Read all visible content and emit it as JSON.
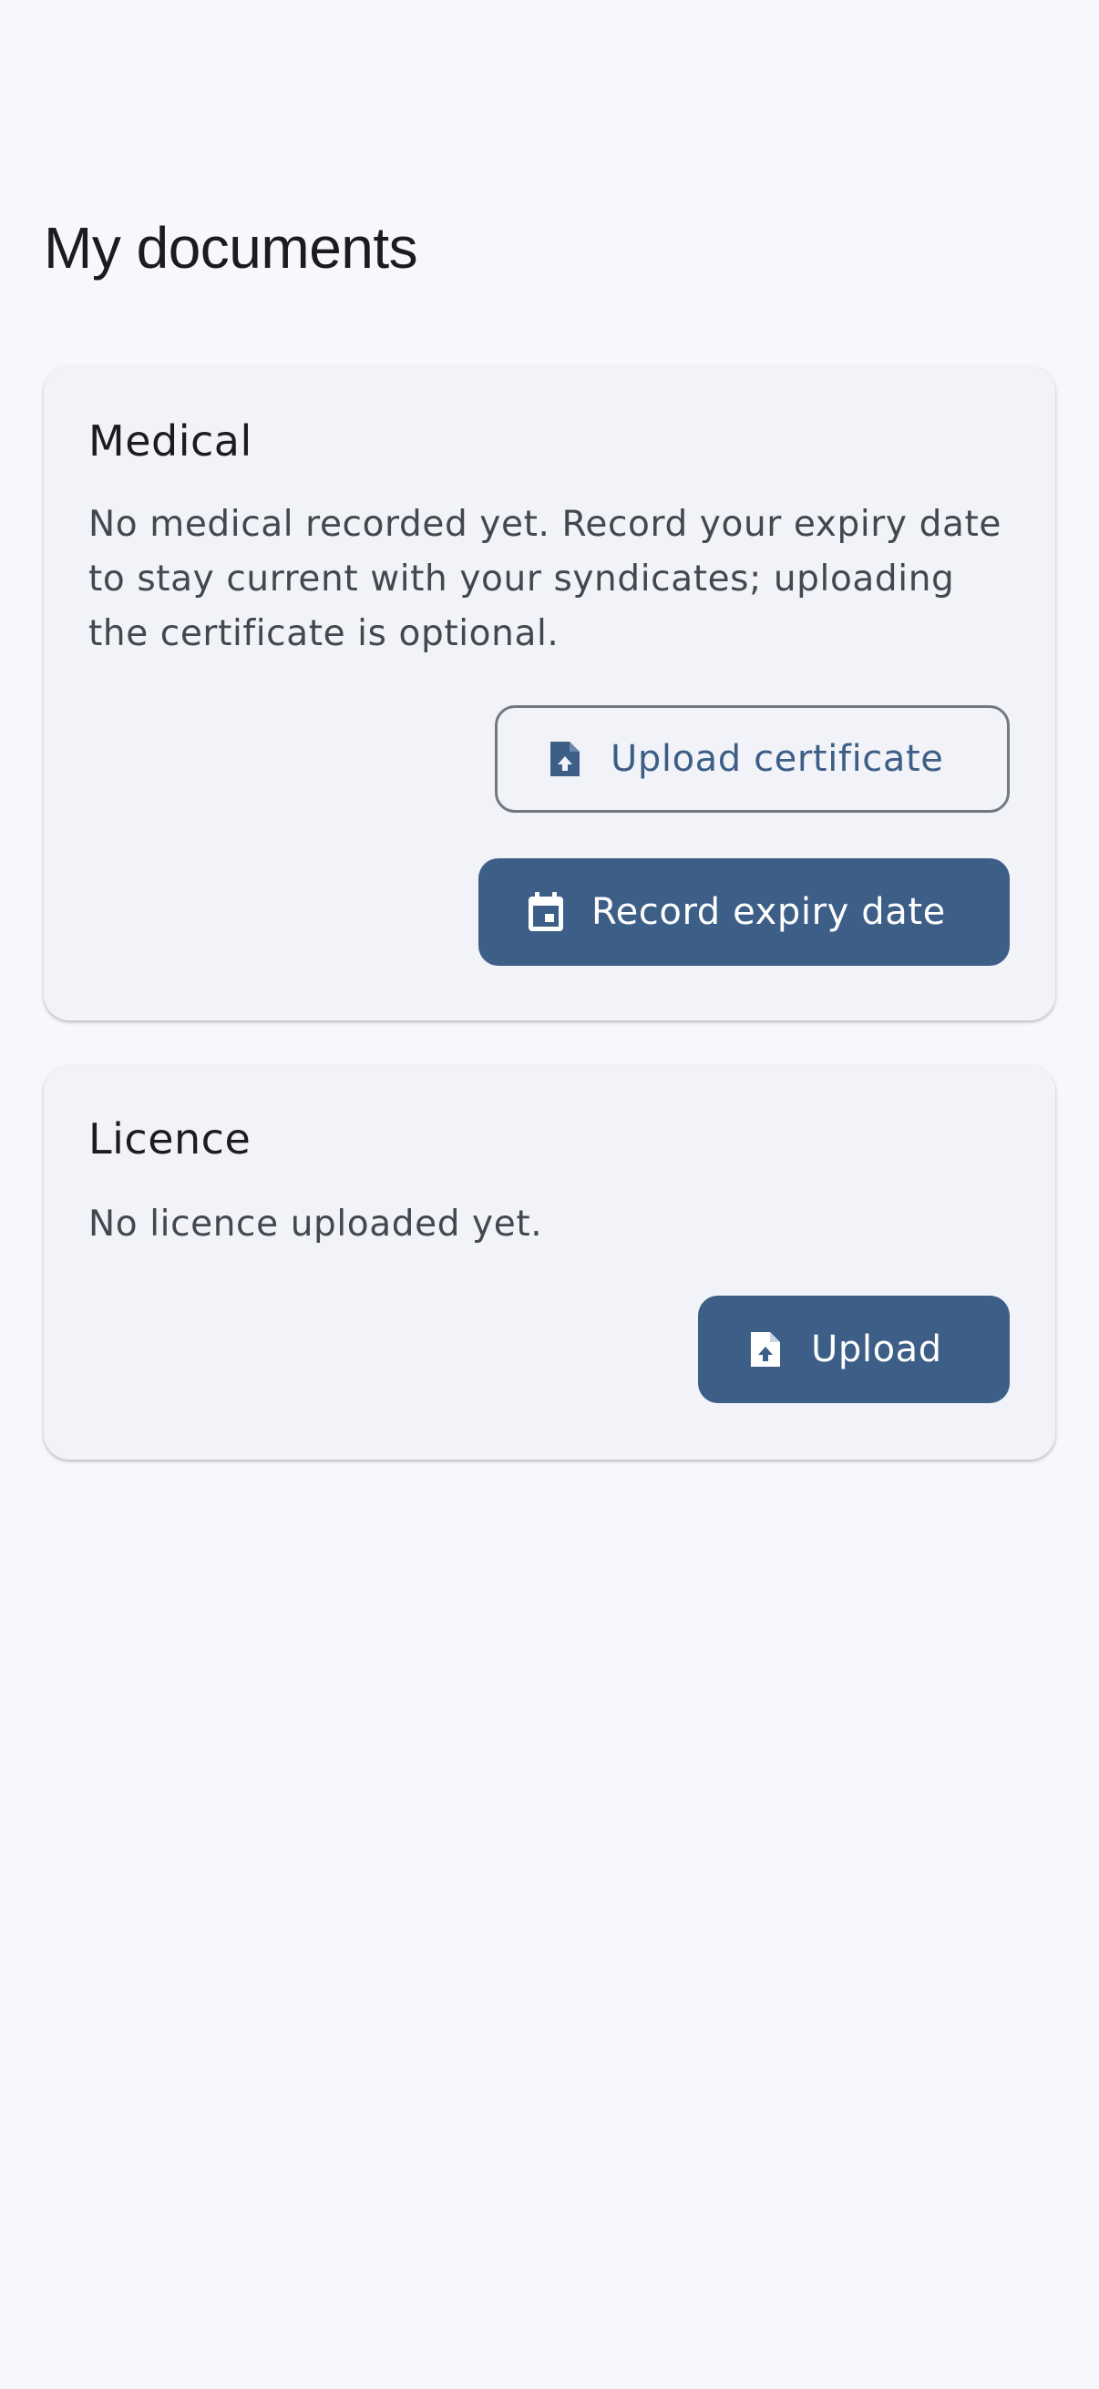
{
  "page": {
    "title": "My documents"
  },
  "medical": {
    "title": "Medical",
    "description": "No medical recorded yet. Record your expiry date to stay current with your syndicates; uploading the certificate is optional.",
    "upload_button": {
      "label": "Upload certificate",
      "icon": "file-upload-icon"
    },
    "record_button": {
      "label": "Record expiry date",
      "icon": "calendar-icon"
    }
  },
  "licence": {
    "title": "Licence",
    "description": "No licence uploaded yet.",
    "upload_button": {
      "label": "Upload",
      "icon": "file-upload-icon"
    }
  },
  "colors": {
    "background": "#f7f8fd",
    "card": "#f1f3f8",
    "primary": "#3d5f87",
    "outline": "#75777f",
    "on_surface": "#1b1c20",
    "on_surface_variant": "#45474e"
  }
}
